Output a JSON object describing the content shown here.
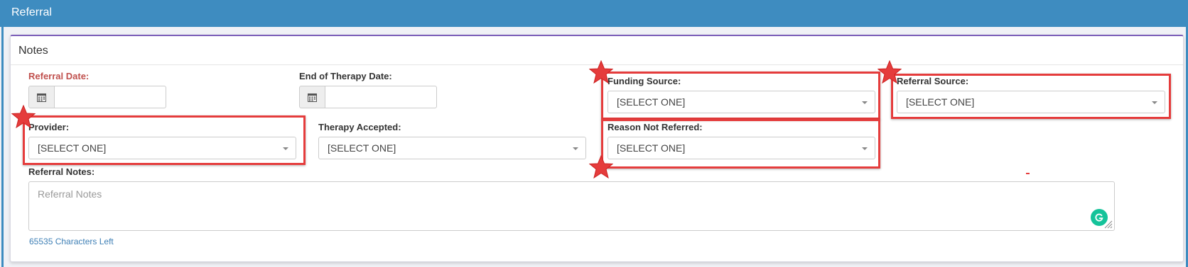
{
  "header": {
    "title": "Referral"
  },
  "panel": {
    "title": "Notes"
  },
  "form": {
    "referral_date": {
      "label": "Referral Date:",
      "value": ""
    },
    "end_therapy_date": {
      "label": "End of Therapy Date:",
      "value": ""
    },
    "funding_source": {
      "label": "Funding Source:",
      "value": "[SELECT ONE]"
    },
    "referral_source": {
      "label": "Referral Source:",
      "value": "[SELECT ONE]"
    },
    "provider": {
      "label": "Provider:",
      "value": "[SELECT ONE]"
    },
    "therapy_accepted": {
      "label": "Therapy Accepted:",
      "value": "[SELECT ONE]"
    },
    "reason_not_referred": {
      "label": "Reason Not Referred:",
      "value": "[SELECT ONE]"
    },
    "referral_notes": {
      "label": "Referral Notes:",
      "placeholder": "Referral Notes",
      "chars_left": "65535 Characters Left"
    }
  },
  "colors": {
    "header_blue": "#3e8cc0",
    "required_label": "#c0504d",
    "highlight_red": "#e53c3c",
    "panel_accent": "#7a5db8",
    "link_blue": "#3e7fb5"
  },
  "icons": [
    "calendar-icon",
    "chevron-down-icon",
    "grammarly-icon",
    "resize-handle-icon",
    "star-annotation-icon"
  ]
}
